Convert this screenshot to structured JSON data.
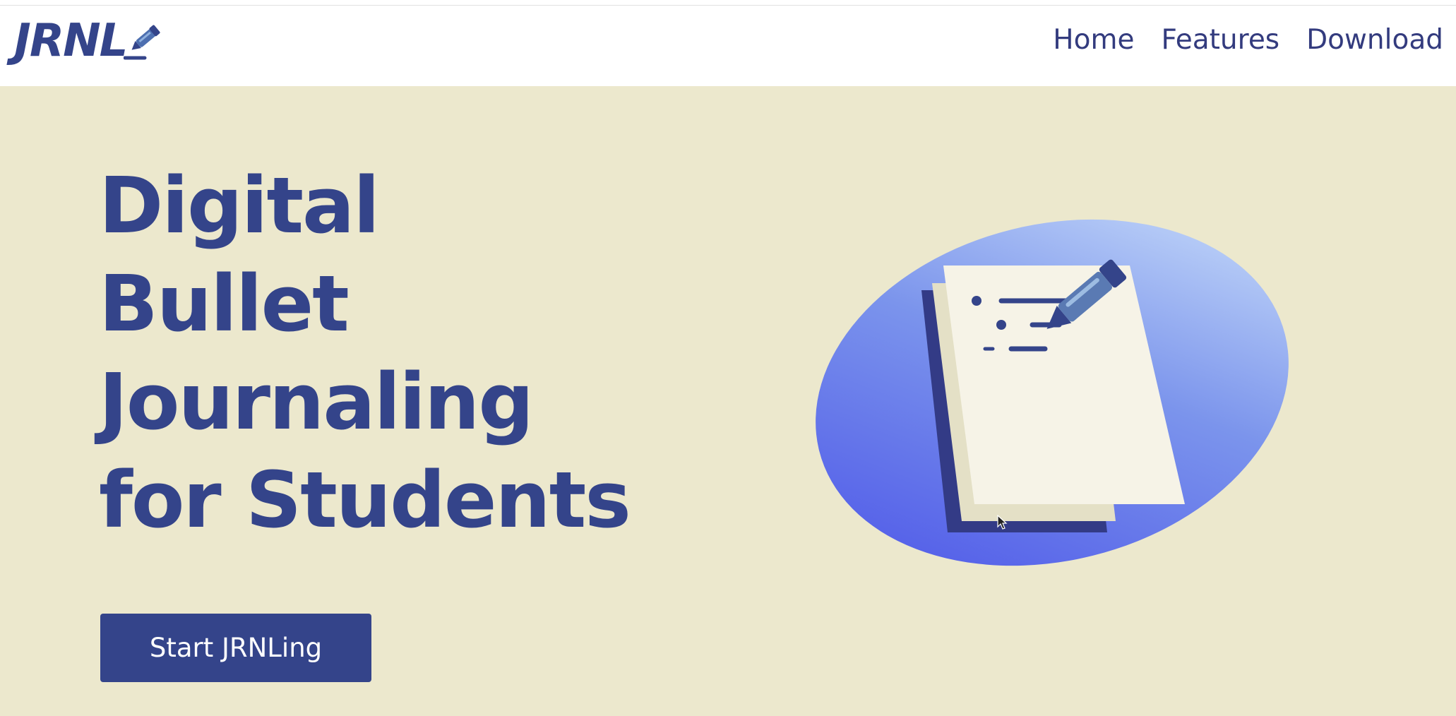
{
  "brand": {
    "name": "JRNL",
    "logo_icon": "pen-icon",
    "color_primary": "#34448a",
    "color_background": "#ece8cd"
  },
  "nav": {
    "items": [
      {
        "label": "Home"
      },
      {
        "label": "Features"
      },
      {
        "label": "Download"
      }
    ]
  },
  "hero": {
    "title_lines": [
      "Digital",
      "Bullet",
      "Journaling",
      "for Students"
    ],
    "cta_label": "Start JRNLing",
    "illustration_icon": "notebook-pen-illustration"
  }
}
